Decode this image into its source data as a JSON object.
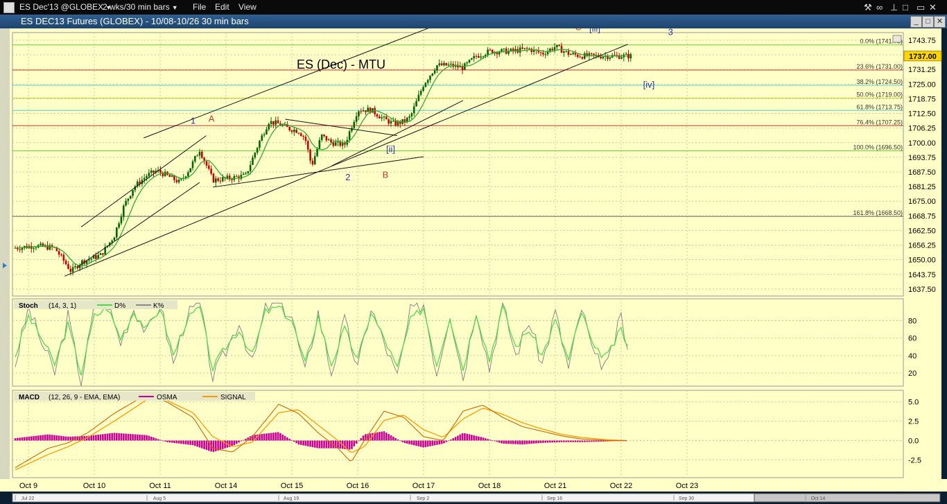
{
  "menubar": {
    "symbol": "ES Dec'13 @GLOBEX",
    "period": "2 wks/30 min bars",
    "menus": [
      "File",
      "Edit",
      "View"
    ]
  },
  "window": {
    "title": "ES DEC13 Futures (GLOBEX) - 10/08-10/26 30 min bars"
  },
  "colors": {
    "background": "#ffffc8",
    "up_bar": "#006600",
    "down_bar": "#cc0000",
    "ma": "#33aa33",
    "stoch_d": "#44dd44",
    "stoch_k": "#888888",
    "macd_line": "#cc6600",
    "signal": "#ff9900",
    "osma": "#cc0099"
  },
  "chart_data": [
    {
      "type": "line",
      "title": "ES (Dec) - MTU",
      "y_ticks": [
        "1743.75",
        "1737.50",
        "1731.25",
        "1725.00",
        "1718.75",
        "1712.50",
        "1706.25",
        "1700.00",
        "1693.75",
        "1687.50",
        "1681.25",
        "1675.00",
        "1668.75",
        "1662.50",
        "1656.25",
        "1650.00",
        "1643.75",
        "1637.50"
      ],
      "ylim": [
        1634.5,
        1747
      ],
      "last_price": "1737.00",
      "x_ticks": [
        "Oct 9",
        "Oct 10",
        "Oct 11",
        "Oct 14",
        "Oct 15",
        "Oct 16",
        "Oct 17",
        "Oct 18",
        "Oct 21",
        "Oct 22",
        "Oct 23"
      ],
      "series": [
        {
          "x": [
            0,
            0.3,
            0.6,
            0.85,
            1.0,
            1.3,
            1.5,
            1.65,
            1.8,
            2.0,
            2.15,
            2.3,
            2.5,
            2.65,
            2.8,
            3.0,
            3.3,
            3.5,
            3.7,
            3.85,
            4.0,
            4.15,
            4.3,
            4.4,
            4.5,
            4.65,
            4.8,
            5.0,
            5.2,
            5.4,
            5.6,
            5.75,
            5.9,
            6.0,
            6.2,
            6.4,
            6.6,
            6.8,
            7.0,
            7.2,
            7.5,
            7.8,
            8.0,
            8.2,
            8.4,
            8.6,
            8.8,
            9.0,
            9.15,
            9.35
          ],
          "values": [
            1655,
            1656,
            1655,
            1645,
            1649,
            1652,
            1660,
            1673,
            1681,
            1686,
            1688,
            1686,
            1683,
            1689,
            1697,
            1684,
            1685,
            1686,
            1700,
            1709,
            1708,
            1706,
            1705,
            1702,
            1690,
            1703,
            1700,
            1699,
            1714,
            1714,
            1710,
            1708,
            1709,
            1711,
            1725,
            1733,
            1733,
            1732,
            1737,
            1739,
            1739,
            1740,
            1738,
            1741,
            1738,
            1737,
            1737,
            1737,
            1737,
            1737
          ]
        }
      ],
      "fib_levels": [
        {
          "label": "0.0% (1741.75)",
          "value": 1741.75,
          "color": "#66cc33"
        },
        {
          "label": "23.6% (1731.00)",
          "value": 1731.0,
          "color": "#cc3333"
        },
        {
          "label": "38.2% (1724.50)",
          "value": 1724.5,
          "color": "#55cccc"
        },
        {
          "label": "50.0% (1719.00)",
          "value": 1719.0,
          "color": "#cccc33"
        },
        {
          "label": "61.8% (1713.75)",
          "value": 1713.75,
          "color": "#55cccc"
        },
        {
          "label": "76.4% (1707.25)",
          "value": 1707.25,
          "color": "#cc3333"
        },
        {
          "label": "100.0% (1696.50)",
          "value": 1696.5,
          "color": "#66cc33"
        },
        {
          "label": "161.8% (1668.50)",
          "value": 1668.5,
          "color": "#666666"
        }
      ],
      "trendlines": [
        {
          "x1": 1.0,
          "y1": 1664,
          "x2": 2.9,
          "y2": 1703
        },
        {
          "x1": 1.95,
          "y1": 1702,
          "x2": 7.3,
          "y2": 1760
        },
        {
          "x1": 0.75,
          "y1": 1643,
          "x2": 9.3,
          "y2": 1742
        },
        {
          "x1": 0.95,
          "y1": 1647,
          "x2": 2.8,
          "y2": 1683
        },
        {
          "x1": 3.0,
          "y1": 1681,
          "x2": 6.2,
          "y2": 1694
        },
        {
          "x1": 4.1,
          "y1": 1710,
          "x2": 5.8,
          "y2": 1703
        },
        {
          "x1": 4.8,
          "y1": 1690,
          "x2": 6.8,
          "y2": 1718
        }
      ],
      "wave_labels": [
        {
          "text": "1",
          "x": 2.7,
          "value": 1708,
          "color": "#3333aa"
        },
        {
          "text": "A",
          "x": 2.98,
          "value": 1709,
          "color": "#cc3333"
        },
        {
          "text": "[ii]",
          "x": 5.7,
          "value": 1696,
          "color": "#3333aa"
        },
        {
          "text": "2",
          "x": 5.05,
          "value": 1684,
          "color": "#3333aa"
        },
        {
          "text": "B",
          "x": 5.62,
          "value": 1685,
          "color": "#cc3333"
        },
        {
          "text": "C",
          "x": 8.55,
          "value": 1748,
          "color": "#cc3333"
        },
        {
          "text": "[iii]",
          "x": 8.8,
          "value": 1747.5,
          "color": "#3333aa"
        },
        {
          "text": "3",
          "x": 9.95,
          "value": 1746,
          "color": "#3333aa"
        },
        {
          "text": "[iv]",
          "x": 9.62,
          "value": 1723.5,
          "color": "#3333aa"
        }
      ]
    },
    {
      "type": "line",
      "title": "Stoch",
      "params": "(14, 3, 1)",
      "legend": [
        "D%",
        "K%"
      ],
      "y_ticks": [
        "80",
        "60",
        "40",
        "20"
      ],
      "ylim": [
        5,
        105
      ],
      "series": [
        {
          "name": "D%",
          "x": [
            0,
            0.2,
            0.4,
            0.6,
            0.8,
            1.0,
            1.2,
            1.4,
            1.6,
            1.8,
            2.0,
            2.2,
            2.4,
            2.6,
            2.8,
            3.0,
            3.2,
            3.4,
            3.6,
            3.8,
            4.0,
            4.2,
            4.4,
            4.6,
            4.8,
            5.0,
            5.2,
            5.4,
            5.6,
            5.8,
            6.0,
            6.2,
            6.4,
            6.6,
            6.8,
            7.0,
            7.2,
            7.4,
            7.6,
            7.8,
            8.0,
            8.2,
            8.4,
            8.6,
            8.8,
            9.0,
            9.2,
            9.3
          ],
          "values": [
            40,
            85,
            60,
            30,
            75,
            20,
            85,
            95,
            60,
            90,
            70,
            95,
            40,
            80,
            95,
            25,
            50,
            70,
            40,
            90,
            95,
            80,
            30,
            85,
            30,
            70,
            35,
            90,
            60,
            25,
            80,
            95,
            30,
            85,
            25,
            90,
            35,
            95,
            50,
            70,
            40,
            80,
            35,
            90,
            45,
            40,
            70,
            50
          ]
        },
        {
          "name": "K%",
          "x": [
            0,
            0.2,
            0.4,
            0.6,
            0.8,
            1.0,
            1.2,
            1.4,
            1.6,
            1.8,
            2.0,
            2.2,
            2.4,
            2.6,
            2.8,
            3.0,
            3.2,
            3.4,
            3.6,
            3.8,
            4.0,
            4.2,
            4.4,
            4.6,
            4.8,
            5.0,
            5.2,
            5.4,
            5.6,
            5.8,
            6.0,
            6.2,
            6.4,
            6.6,
            6.8,
            7.0,
            7.2,
            7.4,
            7.6,
            7.8,
            8.0,
            8.2,
            8.4,
            8.6,
            8.8,
            9.0,
            9.2,
            9.3
          ],
          "values": [
            30,
            95,
            55,
            20,
            85,
            10,
            95,
            100,
            55,
            95,
            65,
            100,
            30,
            85,
            100,
            15,
            45,
            80,
            30,
            95,
            100,
            85,
            20,
            90,
            20,
            80,
            25,
            95,
            55,
            15,
            90,
            100,
            20,
            90,
            15,
            95,
            25,
            100,
            40,
            80,
            30,
            90,
            25,
            95,
            35,
            30,
            85,
            45
          ]
        }
      ]
    },
    {
      "type": "line",
      "title": "MACD",
      "params": "(12, 26, 9 - EMA, EMA)",
      "legend": [
        "OSMA",
        "SIGNAL"
      ],
      "y_ticks": [
        "5.0",
        "2.5",
        "0.0",
        "-2.5"
      ],
      "ylim": [
        -4.8,
        6.5
      ],
      "series": [
        {
          "name": "MACD",
          "x": [
            0,
            0.5,
            0.8,
            1.1,
            1.5,
            2.0,
            2.3,
            2.7,
            3.0,
            3.3,
            3.6,
            4.0,
            4.3,
            4.6,
            4.9,
            5.1,
            5.3,
            5.6,
            5.9,
            6.2,
            6.5,
            6.8,
            7.1,
            7.4,
            7.7,
            8.0,
            8.3,
            8.6,
            9.0,
            9.3
          ],
          "values": [
            -3.5,
            -1.0,
            -0.3,
            1.0,
            3.5,
            6.0,
            5.0,
            3.0,
            -1.0,
            -1.5,
            0.5,
            4.7,
            3.5,
            1.0,
            -1.0,
            -2.8,
            0,
            3.8,
            3.0,
            0.5,
            0,
            3.8,
            4.6,
            3.0,
            1.8,
            1.2,
            0.6,
            0.2,
            0,
            0
          ]
        },
        {
          "name": "SIGNAL",
          "x": [
            0,
            0.5,
            0.8,
            1.1,
            1.5,
            2.0,
            2.3,
            2.7,
            3.0,
            3.3,
            3.6,
            4.0,
            4.3,
            4.6,
            4.9,
            5.1,
            5.3,
            5.6,
            5.9,
            6.2,
            6.5,
            6.8,
            7.1,
            7.4,
            7.7,
            8.0,
            8.3,
            8.6,
            9.0,
            9.3
          ],
          "values": [
            -3.8,
            -1.8,
            -0.8,
            0.4,
            2.5,
            5.3,
            5.2,
            3.6,
            0.5,
            -0.8,
            -0.2,
            3.6,
            4.0,
            2.0,
            0.0,
            -1.6,
            -0.8,
            2.6,
            3.3,
            1.4,
            0.4,
            2.8,
            4.2,
            3.4,
            2.3,
            1.5,
            0.8,
            0.4,
            0.1,
            0
          ]
        },
        {
          "name": "OSMA",
          "x": [
            0,
            0.5,
            0.8,
            1.1,
            1.5,
            2.0,
            2.3,
            2.7,
            3.0,
            3.3,
            3.6,
            4.0,
            4.3,
            4.6,
            4.9,
            5.1,
            5.3,
            5.6,
            5.9,
            6.2,
            6.5,
            6.8,
            7.1,
            7.4,
            7.7,
            8.0,
            8.3,
            8.6,
            9.0,
            9.3
          ],
          "values": [
            0.3,
            0.8,
            0.5,
            0.6,
            1.0,
            0.7,
            -0.2,
            -0.6,
            -1.5,
            -0.7,
            0.7,
            1.1,
            -0.5,
            -1.0,
            -1.0,
            -1.2,
            0.8,
            1.2,
            -0.3,
            -0.9,
            -0.4,
            1.0,
            0.4,
            -0.4,
            -0.5,
            -0.3,
            -0.2,
            -0.2,
            -0.1,
            0
          ]
        }
      ]
    }
  ],
  "timeline": [
    "Jul 22",
    "Aug 5",
    "Aug 19",
    "Sep 2",
    "Sep 16",
    "Sep 30",
    "Oct 14"
  ]
}
